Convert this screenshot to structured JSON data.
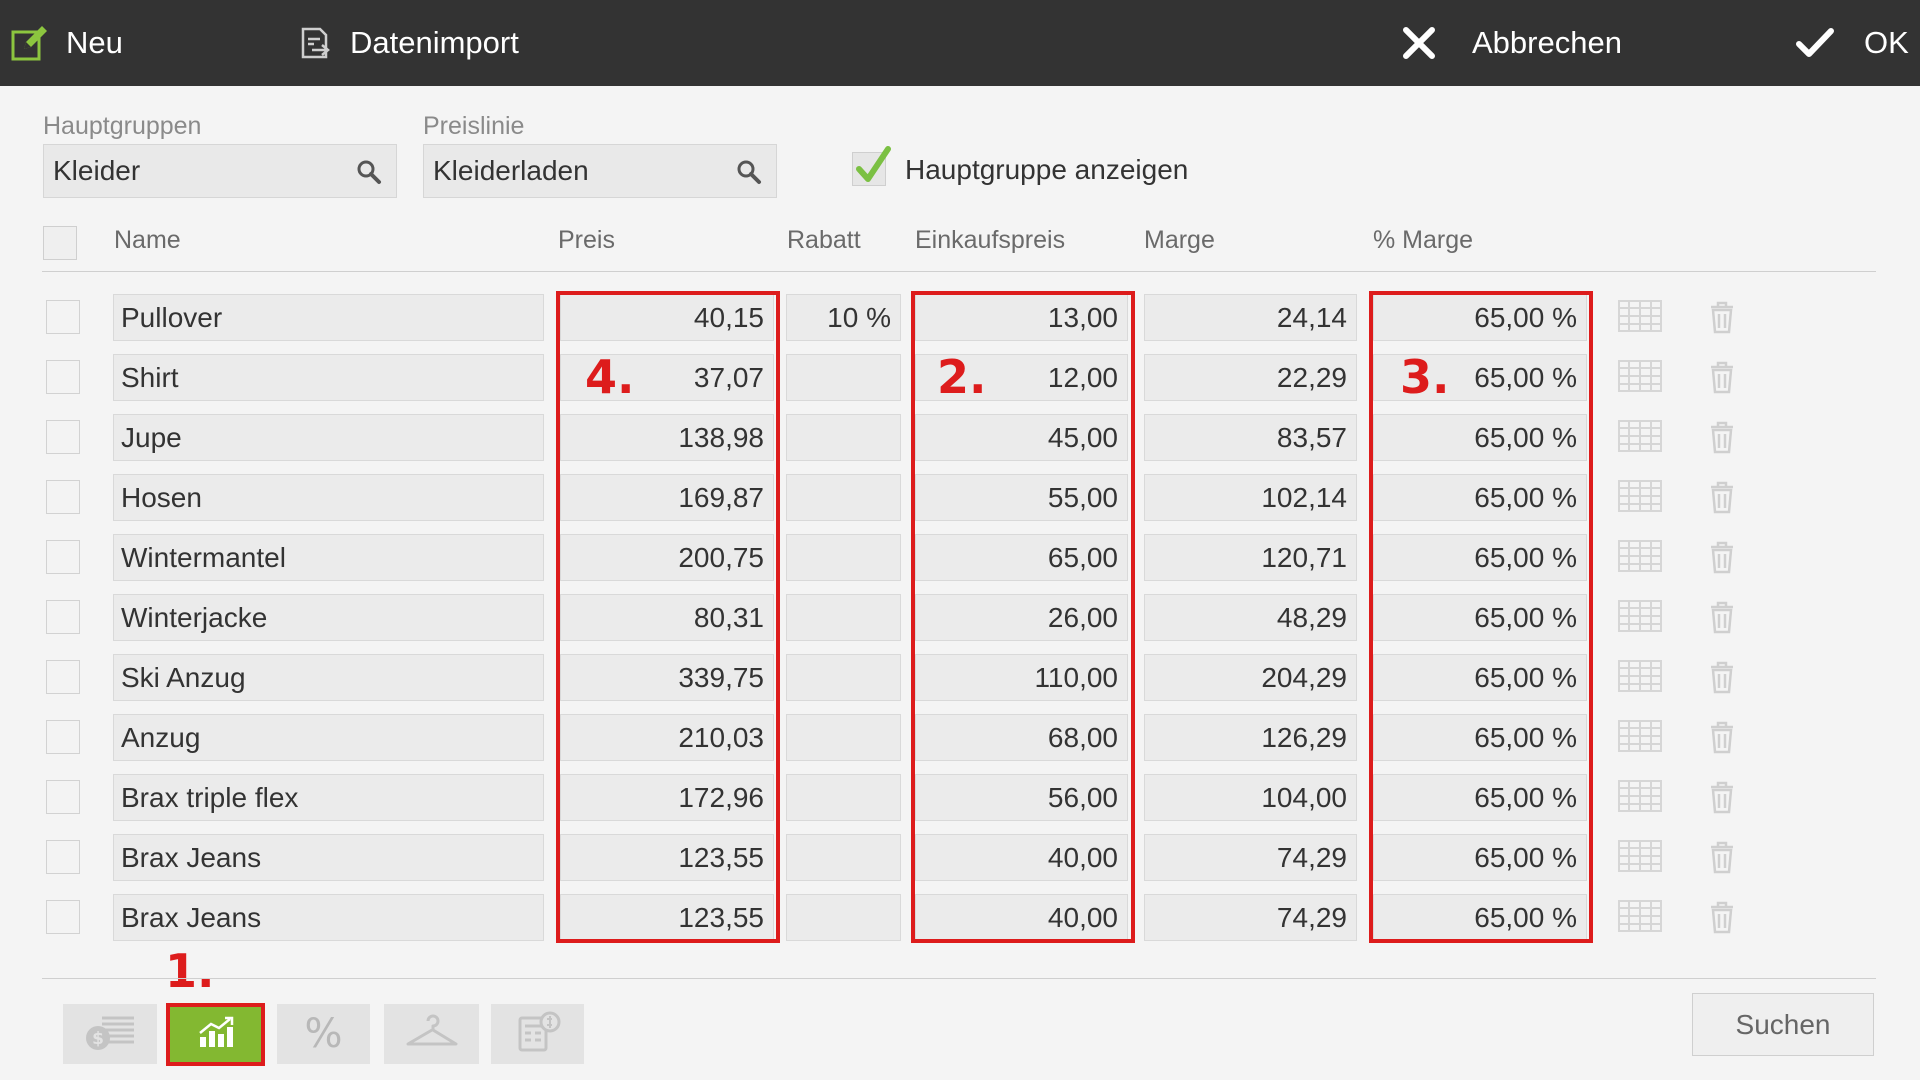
{
  "toolbar": {
    "new_label": "Neu",
    "import_label": "Datenimport",
    "cancel_label": "Abbrechen",
    "ok_label": "OK"
  },
  "filters": {
    "group_label": "Hauptgruppen",
    "group_value": "Kleider",
    "priceline_label": "Preislinie",
    "priceline_value": "Kleiderladen",
    "show_group_label": "Hauptgruppe anzeigen",
    "show_group_checked": true
  },
  "table": {
    "headers": {
      "name": "Name",
      "preis": "Preis",
      "rabatt": "Rabatt",
      "ek": "Einkaufspreis",
      "marge": "Marge",
      "pmarge": "% Marge"
    },
    "rows": [
      {
        "name": "Pullover",
        "preis": "40,15",
        "rabatt": "10 %",
        "ek": "13,00",
        "marge": "24,14",
        "pm": "65,00 %"
      },
      {
        "name": "Shirt",
        "preis": "37,07",
        "rabatt": "",
        "ek": "12,00",
        "marge": "22,29",
        "pm": "65,00 %"
      },
      {
        "name": "Jupe",
        "preis": "138,98",
        "rabatt": "",
        "ek": "45,00",
        "marge": "83,57",
        "pm": "65,00 %"
      },
      {
        "name": "Hosen",
        "preis": "169,87",
        "rabatt": "",
        "ek": "55,00",
        "marge": "102,14",
        "pm": "65,00 %"
      },
      {
        "name": "Wintermantel",
        "preis": "200,75",
        "rabatt": "",
        "ek": "65,00",
        "marge": "120,71",
        "pm": "65,00 %"
      },
      {
        "name": "Winterjacke",
        "preis": "80,31",
        "rabatt": "",
        "ek": "26,00",
        "marge": "48,29",
        "pm": "65,00 %"
      },
      {
        "name": "Ski Anzug",
        "preis": "339,75",
        "rabatt": "",
        "ek": "110,00",
        "marge": "204,29",
        "pm": "65,00 %"
      },
      {
        "name": "Anzug",
        "preis": "210,03",
        "rabatt": "",
        "ek": "68,00",
        "marge": "126,29",
        "pm": "65,00 %"
      },
      {
        "name": "Brax triple flex",
        "preis": "172,96",
        "rabatt": "",
        "ek": "56,00",
        "marge": "104,00",
        "pm": "65,00 %"
      },
      {
        "name": "Brax Jeans",
        "preis": "123,55",
        "rabatt": "",
        "ek": "40,00",
        "marge": "74,29",
        "pm": "65,00 %"
      },
      {
        "name": "Brax Jeans",
        "preis": "123,55",
        "rabatt": "",
        "ek": "40,00",
        "marge": "74,29",
        "pm": "65,00 %"
      }
    ]
  },
  "annotations": {
    "step1": "1.",
    "step2": "2.",
    "step3": "3.",
    "step4": "4."
  },
  "bottom": {
    "percent_symbol": "%",
    "search_label": "Suchen",
    "active_tool": "margin-chart"
  },
  "colors": {
    "topbar": "#333333",
    "accent_green": "#83b831",
    "annotation_red": "#dd1c1c"
  }
}
